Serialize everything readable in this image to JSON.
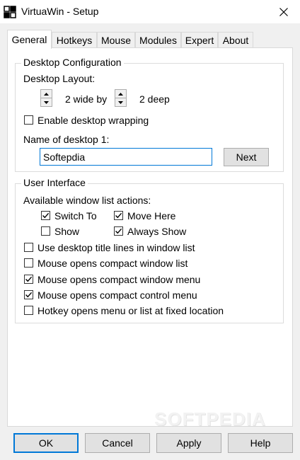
{
  "window": {
    "title": "VirtuaWin - Setup",
    "app_icon": "virtuawin-grid-icon",
    "close_icon": "close-icon"
  },
  "tabs": [
    {
      "label": "General",
      "active": true
    },
    {
      "label": "Hotkeys",
      "active": false
    },
    {
      "label": "Mouse",
      "active": false
    },
    {
      "label": "Modules",
      "active": false
    },
    {
      "label": "Expert",
      "active": false
    },
    {
      "label": "About",
      "active": false
    }
  ],
  "desktop_config": {
    "group_title": "Desktop Configuration",
    "layout_label": "Desktop Layout:",
    "wide_value": "2 wide by",
    "deep_value": "2 deep",
    "wrapping_label": "Enable desktop wrapping",
    "wrapping_checked": false,
    "name_label": "Name of desktop 1:",
    "name_value": "Softepdia",
    "next_button": "Next"
  },
  "user_interface": {
    "group_title": "User Interface",
    "actions_label": "Available window list actions:",
    "switch_to": {
      "label": "Switch To",
      "checked": true
    },
    "move_here": {
      "label": "Move Here",
      "checked": true
    },
    "show": {
      "label": "Show",
      "checked": false
    },
    "always_show": {
      "label": "Always Show",
      "checked": true
    },
    "options": [
      {
        "label": "Use desktop title lines in window list",
        "checked": false
      },
      {
        "label": "Mouse opens compact window list",
        "checked": false
      },
      {
        "label": "Mouse opens compact window menu",
        "checked": true
      },
      {
        "label": "Mouse opens compact control menu",
        "checked": true
      },
      {
        "label": "Hotkey opens menu or list at fixed location",
        "checked": false
      }
    ]
  },
  "watermark": "SOFTPEDIA",
  "buttons": {
    "ok": "OK",
    "cancel": "Cancel",
    "apply": "Apply",
    "help": "Help"
  },
  "colors": {
    "accent": "#0078d7",
    "face": "#f0f0f0",
    "panel": "#ffffff"
  }
}
